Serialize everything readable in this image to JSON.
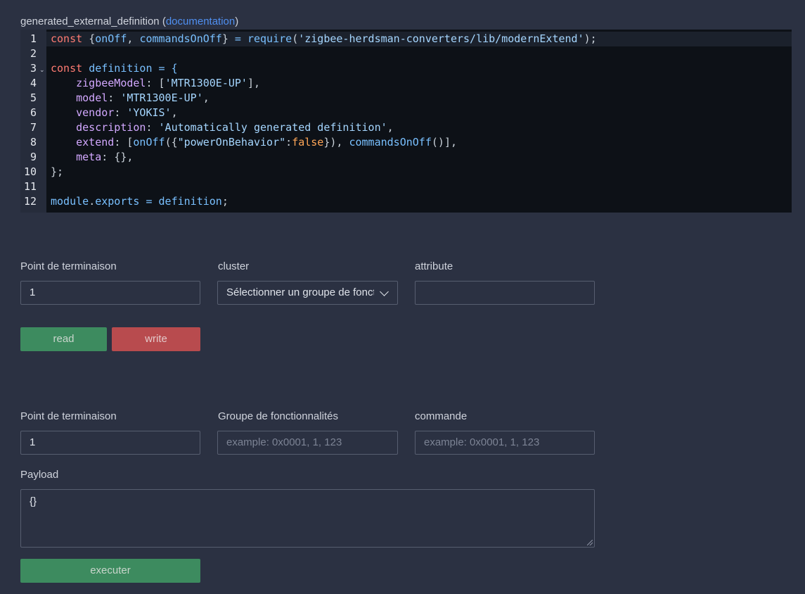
{
  "definition": {
    "title": "generated_external_definition",
    "open_paren": "(",
    "doc_link": "documentation",
    "close_paren": ")"
  },
  "code": {
    "line_numbers": [
      "1",
      "2",
      "3",
      "4",
      "5",
      "6",
      "7",
      "8",
      "9",
      "10",
      "11",
      "12"
    ],
    "fold_marker": "⌄",
    "l1_const": "const ",
    "l1_brace_open": "{",
    "l1_onOff": "onOff",
    "l1_comma": ", ",
    "l1_commandsOnOff": "commandsOnOff",
    "l1_brace_close": "}",
    "l1_eq": " = ",
    "l1_require": "require",
    "l1_paren_open": "(",
    "l1_string": "'zigbee-herdsman-converters/lib/modernExtend'",
    "l1_end": ");",
    "l3_const": "const ",
    "l3_name": "definition",
    "l3_rest": " = {",
    "l4_key": "zigbeeModel",
    "l4_colon": ": ",
    "l4_bracket_open": "[",
    "l4_value": "'MTR1300E-UP'",
    "l4_end": "],",
    "l5_key": "model",
    "l5_colon": ": ",
    "l5_value": "'MTR1300E-UP'",
    "l5_end": ",",
    "l6_key": "vendor",
    "l6_colon": ": ",
    "l6_value": "'YOKIS'",
    "l6_end": ",",
    "l7_key": "description",
    "l7_colon": ": ",
    "l7_value": "'Automatically generated definition'",
    "l7_end": ",",
    "l8_key": "extend",
    "l8_colon": ": ",
    "l8_bracket": "[",
    "l8_onOff": "onOff",
    "l8_paren": "(",
    "l8_obj_open": "{",
    "l8_prop": "\"powerOnBehavior\"",
    "l8_sep": ":",
    "l8_bool": "false",
    "l8_obj_close": "}",
    "l8_paren_close_comma": "), ",
    "l8_commandsOnOff": "commandsOnOff",
    "l8_call_end": "()",
    "l8_end": "],",
    "l9_key": "meta",
    "l9_colon": ": ",
    "l9_value": "{}",
    "l9_end": ",",
    "l10": "};",
    "l12_module": "module",
    "l12_dot": ".",
    "l12_exports": "exports",
    "l12_eq": " = ",
    "l12_value": "definition",
    "l12_end": ";"
  },
  "read_write": {
    "endpoint_label": "Point de terminaison",
    "endpoint_value": "1",
    "cluster_label": "cluster",
    "cluster_selected": "Sélectionner un groupe de fonctionnalités",
    "attribute_label": "attribute",
    "attribute_value": "",
    "read_label": "read",
    "write_label": "write"
  },
  "command": {
    "endpoint_label": "Point de terminaison",
    "endpoint_value": "1",
    "cluster_label": "Groupe de fonctionnalités",
    "cluster_placeholder": "example: 0x0001, 1, 123",
    "command_label": "commande",
    "command_placeholder": "example: 0x0001, 1, 123",
    "payload_label": "Payload",
    "payload_value": "{}",
    "execute_label": "executer"
  },
  "colors": {
    "background": "#2b3142",
    "editor_background": "#0d1117",
    "green_button": "#3d8b5f",
    "red_button": "#b84b4e",
    "link": "#4f8ff0"
  }
}
